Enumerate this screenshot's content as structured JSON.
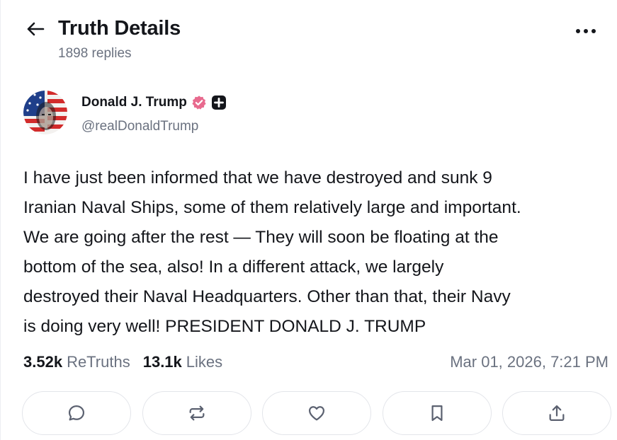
{
  "header": {
    "title": "Truth Details",
    "replies": "1898 replies",
    "back_icon": "arrow-left-icon",
    "more_icon": "more-horizontal-icon"
  },
  "author": {
    "display_name": "Donald J. Trump",
    "handle": "@realDonaldTrump",
    "verified_icon": "verified-badge-icon",
    "plus_icon": "truth-plus-icon",
    "verified_color": "#e86a8e"
  },
  "post": {
    "text": "I have just been informed that we have destroyed and sunk 9\nIranian Naval Ships, some of them relatively large and important.\nWe are going after the rest — They will soon be floating at the\nbottom of the sea, also! In a different attack, we largely\ndestroyed their Naval Headquarters. Other than that, their Navy\nis doing very well! PRESIDENT DONALD J. TRUMP"
  },
  "stats": {
    "retruths_count": "3.52k",
    "retruths_label": "ReTruths",
    "likes_count": "13.1k",
    "likes_label": "Likes",
    "timestamp": "Mar 01, 2026, 7:21 PM"
  },
  "actions": [
    {
      "name": "reply",
      "icon": "comment-icon"
    },
    {
      "name": "retruth",
      "icon": "repost-icon"
    },
    {
      "name": "like",
      "icon": "heart-icon"
    },
    {
      "name": "bookmark",
      "icon": "bookmark-icon"
    },
    {
      "name": "share",
      "icon": "share-icon"
    }
  ],
  "colors": {
    "text": "#14161b",
    "muted": "#6b7280",
    "border": "#e3e5ea",
    "icon": "#5b6170"
  }
}
